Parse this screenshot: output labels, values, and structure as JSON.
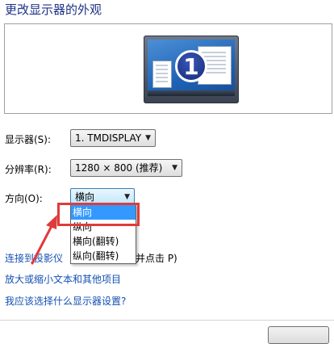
{
  "page_title": "更改显示器的外观",
  "preview": {
    "monitor_number": "1"
  },
  "display": {
    "label": "显示器(S):",
    "value": "1. TMDISPLAY"
  },
  "resolution": {
    "label": "分辨率(R):",
    "value": "1280 × 800 (推荐)"
  },
  "orientation": {
    "label": "方向(O):",
    "value": "横向",
    "options": [
      "横向",
      "纵向",
      "横向(翻转)",
      "纵向(翻转)"
    ],
    "selected_index": 0
  },
  "links": {
    "projector": "连接到投影仪",
    "projector_suffix": "并点击 P)",
    "text_size": "放大或缩小文本和其他项目",
    "help": "我应该选择什么显示器设置?"
  },
  "colors": {
    "highlight": "#e03b3b",
    "link": "#1450b4",
    "title": "#1e3287",
    "selection": "#3399ff"
  },
  "icons": {
    "caret": "▼"
  }
}
